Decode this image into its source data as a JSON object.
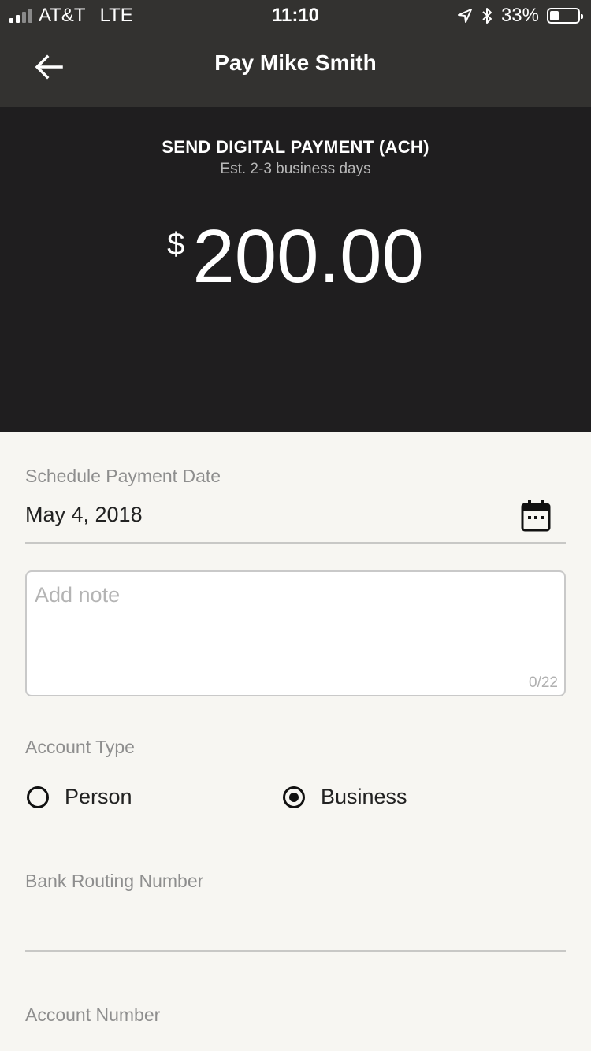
{
  "status_bar": {
    "carrier": "AT&T",
    "network": "LTE",
    "time": "11:10",
    "battery": "33%",
    "battery_level": 0.33,
    "signal_bars_filled": 2,
    "signal_bars_total": 4,
    "icons": [
      "signal-icon",
      "location-arrow-icon",
      "bluetooth-icon",
      "battery-icon"
    ]
  },
  "nav": {
    "title": "Pay Mike Smith",
    "back_icon": "arrow-left-icon"
  },
  "hero": {
    "title": "SEND DIGITAL PAYMENT (ACH)",
    "subtitle": "Est. 2-3 business days",
    "currency": "$",
    "amount": "200.00"
  },
  "form": {
    "schedule_label": "Schedule Payment Date",
    "schedule_value": "May 4, 2018",
    "calendar_icon": "calendar-icon",
    "note_placeholder": "Add note",
    "note_value": "",
    "note_count": "0/22",
    "account_type_label": "Account Type",
    "account_type_options": [
      {
        "label": "Person",
        "selected": false
      },
      {
        "label": "Business",
        "selected": true
      }
    ],
    "routing_label": "Bank Routing Number",
    "routing_value": "",
    "account_number_label": "Account Number"
  },
  "colors": {
    "header_bg": "#333230",
    "hero_bg": "#1f1e1f",
    "page_bg": "#f7f6f2",
    "label_gray": "#8e8e8e"
  }
}
